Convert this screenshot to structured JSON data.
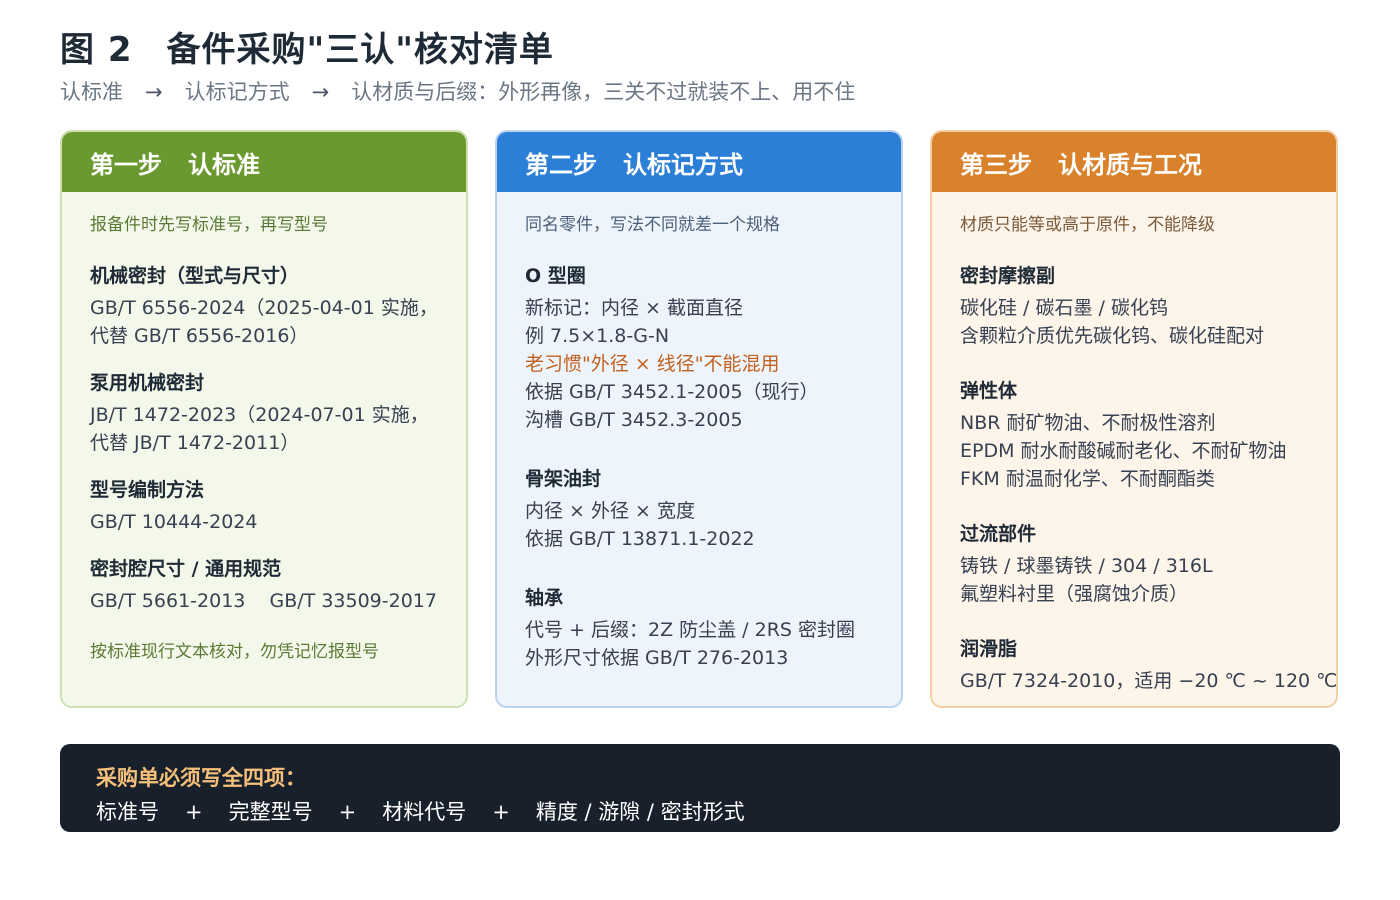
{
  "figure": {
    "number": "图 2",
    "title": "备件采购\"三认\"核对清单",
    "subtitle": {
      "part1": "认标准",
      "arrow": "→",
      "part2": "认标记方式",
      "part3": "认材质与后缀：外形再像，三关不过就装不上、用不住"
    }
  },
  "cards": [
    {
      "step": "第一步",
      "name": "认标准",
      "note": "报备件时先写标准号，再写型号",
      "sections": [
        {
          "title": "机械密封（型式与尺寸）",
          "lines": [
            "GB/T 6556-2024（2025-04-01 实施，",
            "代替 GB/T 6556-2016）"
          ]
        },
        {
          "title": "泵用机械密封",
          "lines": [
            "JB/T 1472-2023（2024-07-01 实施，",
            "代替 JB/T 1472-2011）"
          ]
        },
        {
          "title": "型号编制方法",
          "lines": [
            "GB/T 10444-2024"
          ]
        },
        {
          "title": "密封腔尺寸 / 通用规范",
          "lines": [
            "GB/T 5661-2013    GB/T 33509-2017"
          ]
        }
      ],
      "footnote": "按标准现行文本核对，勿凭记忆报型号"
    },
    {
      "step": "第二步",
      "name": "认标记方式",
      "note": "同名零件，写法不同就差一个规格",
      "sections": [
        {
          "title": "O 型圈",
          "lines": [
            "新标记：内径 × 截面直径",
            "例 7.5×1.8-G-N",
            "老习惯\"外径 × 线径\"不能混用",
            "依据 GB/T 3452.1-2005（现行）",
            "沟槽 GB/T 3452.3-2005"
          ]
        },
        {
          "title": "骨架油封",
          "lines": [
            "内径 × 外径 × 宽度",
            "依据 GB/T 13871.1-2022"
          ]
        },
        {
          "title": "轴承",
          "lines": [
            "代号 + 后缀：2Z 防尘盖 / 2RS 密封圈",
            "外形尺寸依据 GB/T 276-2013"
          ]
        }
      ]
    },
    {
      "step": "第三步",
      "name": "认材质与工况",
      "note": "材质只能等或高于原件，不能降级",
      "sections": [
        {
          "title": "密封摩擦副",
          "lines": [
            "碳化硅 / 碳石墨 / 碳化钨",
            "含颗粒介质优先碳化钨、碳化硅配对"
          ]
        },
        {
          "title": "弹性体",
          "lines": [
            "NBR 耐矿物油、不耐极性溶剂",
            "EPDM 耐水耐酸碱耐老化、不耐矿物油",
            "FKM 耐温耐化学、不耐酮酯类"
          ]
        },
        {
          "title": "过流部件",
          "lines": [
            "铸铁 / 球墨铸铁 / 304 / 316L",
            "氟塑料衬里（强腐蚀介质）"
          ]
        },
        {
          "title": "润滑脂",
          "lines": [
            "GB/T 7324-2010，适用 −20 ℃ ~ 120 ℃"
          ]
        }
      ]
    }
  ],
  "summary": {
    "title": "采购单必须写全四项：",
    "items": [
      "标准号",
      "完整型号",
      "材料代号",
      "精度 / 游隙 / 密封形式"
    ],
    "plus": "+"
  },
  "colors": {
    "step1": "#6a9a2f",
    "step2": "#2b7fd6",
    "step3": "#d9822b",
    "warning_text": "#c2611f",
    "summary_bg": "#18202b",
    "summary_title": "#f6c07a"
  }
}
